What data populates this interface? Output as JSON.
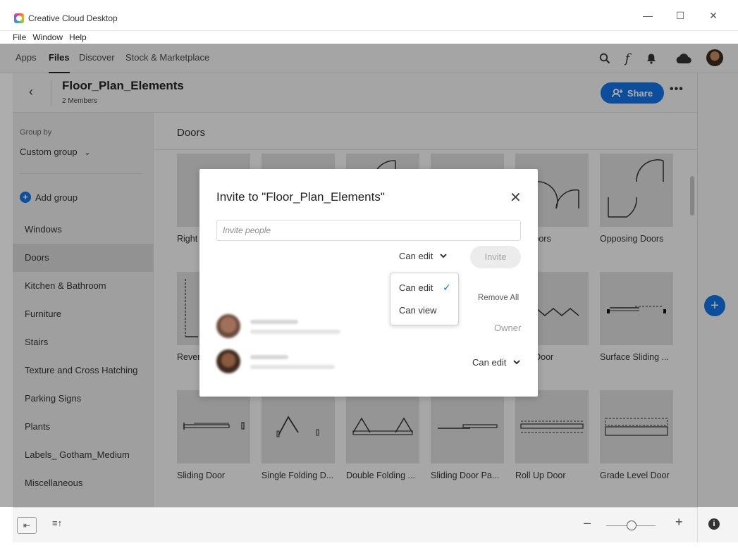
{
  "window": {
    "title": "Creative Cloud Desktop",
    "menu": [
      "File",
      "Window",
      "Help"
    ],
    "controls": {
      "minimize": "—",
      "maximize": "☐",
      "close": "✕"
    }
  },
  "nav": {
    "tabs": [
      {
        "label": "Apps",
        "active": false
      },
      {
        "label": "Files",
        "active": true
      },
      {
        "label": "Discover",
        "active": false
      },
      {
        "label": "Stock & Marketplace",
        "active": false
      }
    ],
    "icons": [
      "search-icon",
      "fonts-icon",
      "bell-icon",
      "cloud-icon",
      "user-avatar"
    ],
    "fonts_glyph": "f"
  },
  "folder": {
    "title": "Floor_Plan_Elements",
    "members": "2 Members",
    "share_label": "Share"
  },
  "sidebar": {
    "group_by_label": "Group by",
    "group_by_value": "Custom group",
    "add_group_label": "Add group",
    "items": [
      {
        "label": "Windows",
        "selected": false
      },
      {
        "label": "Doors",
        "selected": true
      },
      {
        "label": "Kitchen & Bathroom",
        "selected": false
      },
      {
        "label": "Furniture",
        "selected": false
      },
      {
        "label": "Stairs",
        "selected": false
      },
      {
        "label": "Texture and Cross Hatching",
        "selected": false
      },
      {
        "label": "Parking Signs",
        "selected": false
      },
      {
        "label": "Plants",
        "selected": false
      },
      {
        "label": "Labels_ Gotham_Medium",
        "selected": false
      },
      {
        "label": "Miscellaneous",
        "selected": false
      }
    ]
  },
  "main": {
    "section_title": "Doors",
    "row1_labels": [
      "Right",
      "",
      "",
      "",
      "en Doors",
      "Opposing Doors"
    ],
    "row2_labels": [
      "Rever",
      "",
      "",
      "",
      "dion Door",
      "Surface Sliding ..."
    ],
    "row3_labels": [
      "Sliding Door",
      "Single Folding D...",
      "Double Folding ...",
      "Sliding Door Pa...",
      "Roll Up Door",
      "Grade Level Door"
    ]
  },
  "dialog": {
    "title": "Invite to \"Floor_Plan_Elements\"",
    "close": "✕",
    "input_placeholder": "Invite people",
    "permission": "Can edit",
    "invite_label": "Invite",
    "remove_all_label": "Remove All",
    "owner_label": "Owner",
    "member_permission": "Can edit",
    "dropdown": {
      "options": [
        "Can edit",
        "Can view"
      ],
      "selected": "Can edit"
    }
  },
  "colors": {
    "accent": "#1473e6"
  }
}
